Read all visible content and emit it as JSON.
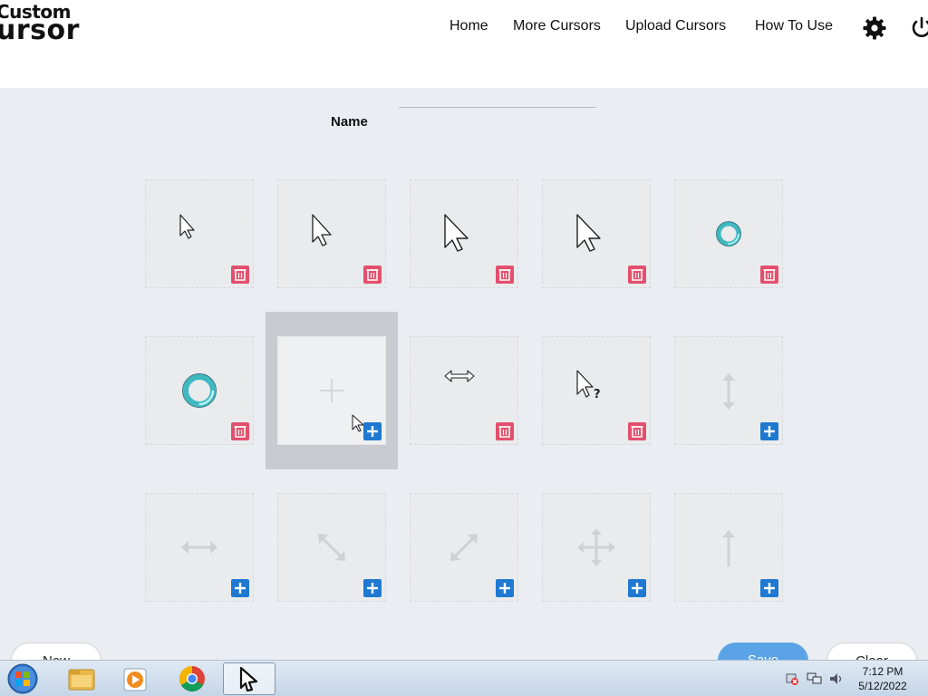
{
  "app": {
    "logo_line1": "Custom",
    "logo_line2": "ursor"
  },
  "nav": {
    "items": [
      {
        "label": "Home"
      },
      {
        "label": "More Cursors"
      },
      {
        "label": "Upload Cursors"
      },
      {
        "label": "How To Use"
      }
    ],
    "settings_icon": "gear-icon",
    "power_icon": "power-icon"
  },
  "form": {
    "name_label": "Name",
    "name_value": "",
    "name_placeholder": ""
  },
  "grid": {
    "cells": [
      {
        "cursor": "arrow-small",
        "action": "delete"
      },
      {
        "cursor": "arrow-medium",
        "action": "delete"
      },
      {
        "cursor": "arrow-large",
        "action": "delete"
      },
      {
        "cursor": "arrow-large",
        "action": "delete"
      },
      {
        "cursor": "busy-ring-small",
        "action": "delete"
      },
      {
        "cursor": "busy-ring-large",
        "action": "delete"
      },
      {
        "cursor": "empty-plus",
        "action": "add"
      },
      {
        "cursor": "horizontal-resize",
        "action": "delete"
      },
      {
        "cursor": "help-arrow",
        "action": "delete"
      },
      {
        "cursor": "vertical-resize-placeholder",
        "action": "add"
      },
      {
        "cursor": "horizontal-resize-placeholder",
        "action": "add"
      },
      {
        "cursor": "diagonal-resize-nwse-placeholder",
        "action": "add"
      },
      {
        "cursor": "diagonal-resize-nesw-placeholder",
        "action": "add"
      },
      {
        "cursor": "move-placeholder",
        "action": "add"
      },
      {
        "cursor": "up-arrow-placeholder",
        "action": "add"
      }
    ]
  },
  "buttons": {
    "new_label": "New",
    "save_label": "Save",
    "clear_label": "Clear"
  },
  "taskbar": {
    "time": "7:12 PM",
    "date": "5/12/2022"
  },
  "colors": {
    "delete": "#e2506d",
    "add": "#1f79d1",
    "background": "#eaeef2"
  }
}
